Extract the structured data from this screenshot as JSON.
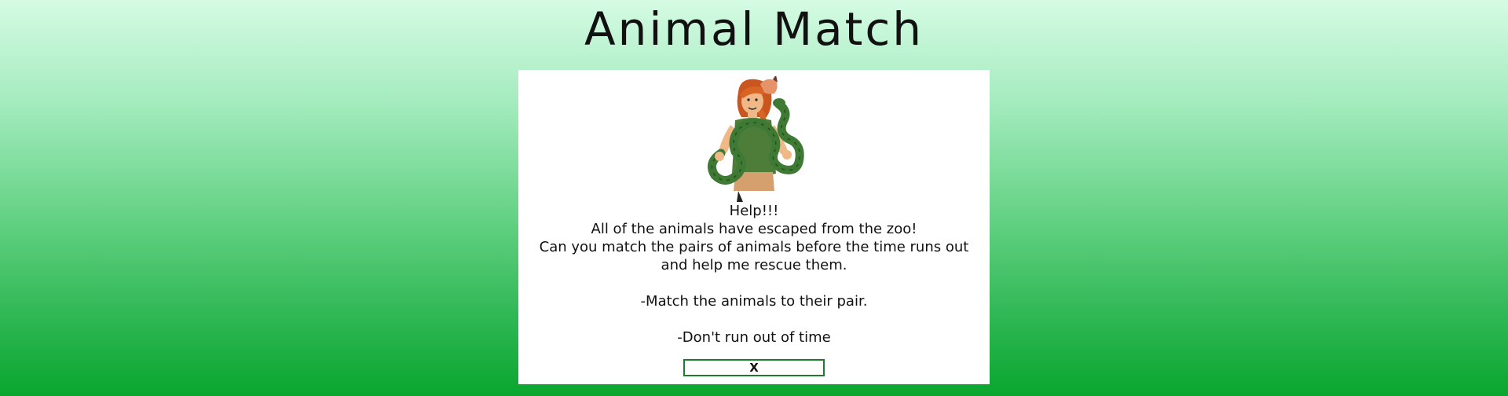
{
  "header": {
    "title": "Animal Match"
  },
  "modal": {
    "illustration_icon": "girl-with-snake-illustration",
    "lines": {
      "l1": "Help!!!",
      "l2": "All of the animals have escaped from the zoo!",
      "l3": "Can you match the pairs of animals before the time runs out",
      "l4": "and help me rescue them.",
      "l5": "-Match the animals to their pair.",
      "l6": "-Don't run out of time"
    },
    "close_label": "X"
  },
  "colors": {
    "background_top": "#d5fbe3",
    "background_bottom": "#09a62e",
    "button_border": "#1f7a2e",
    "snake_green": "#3f7a35"
  }
}
